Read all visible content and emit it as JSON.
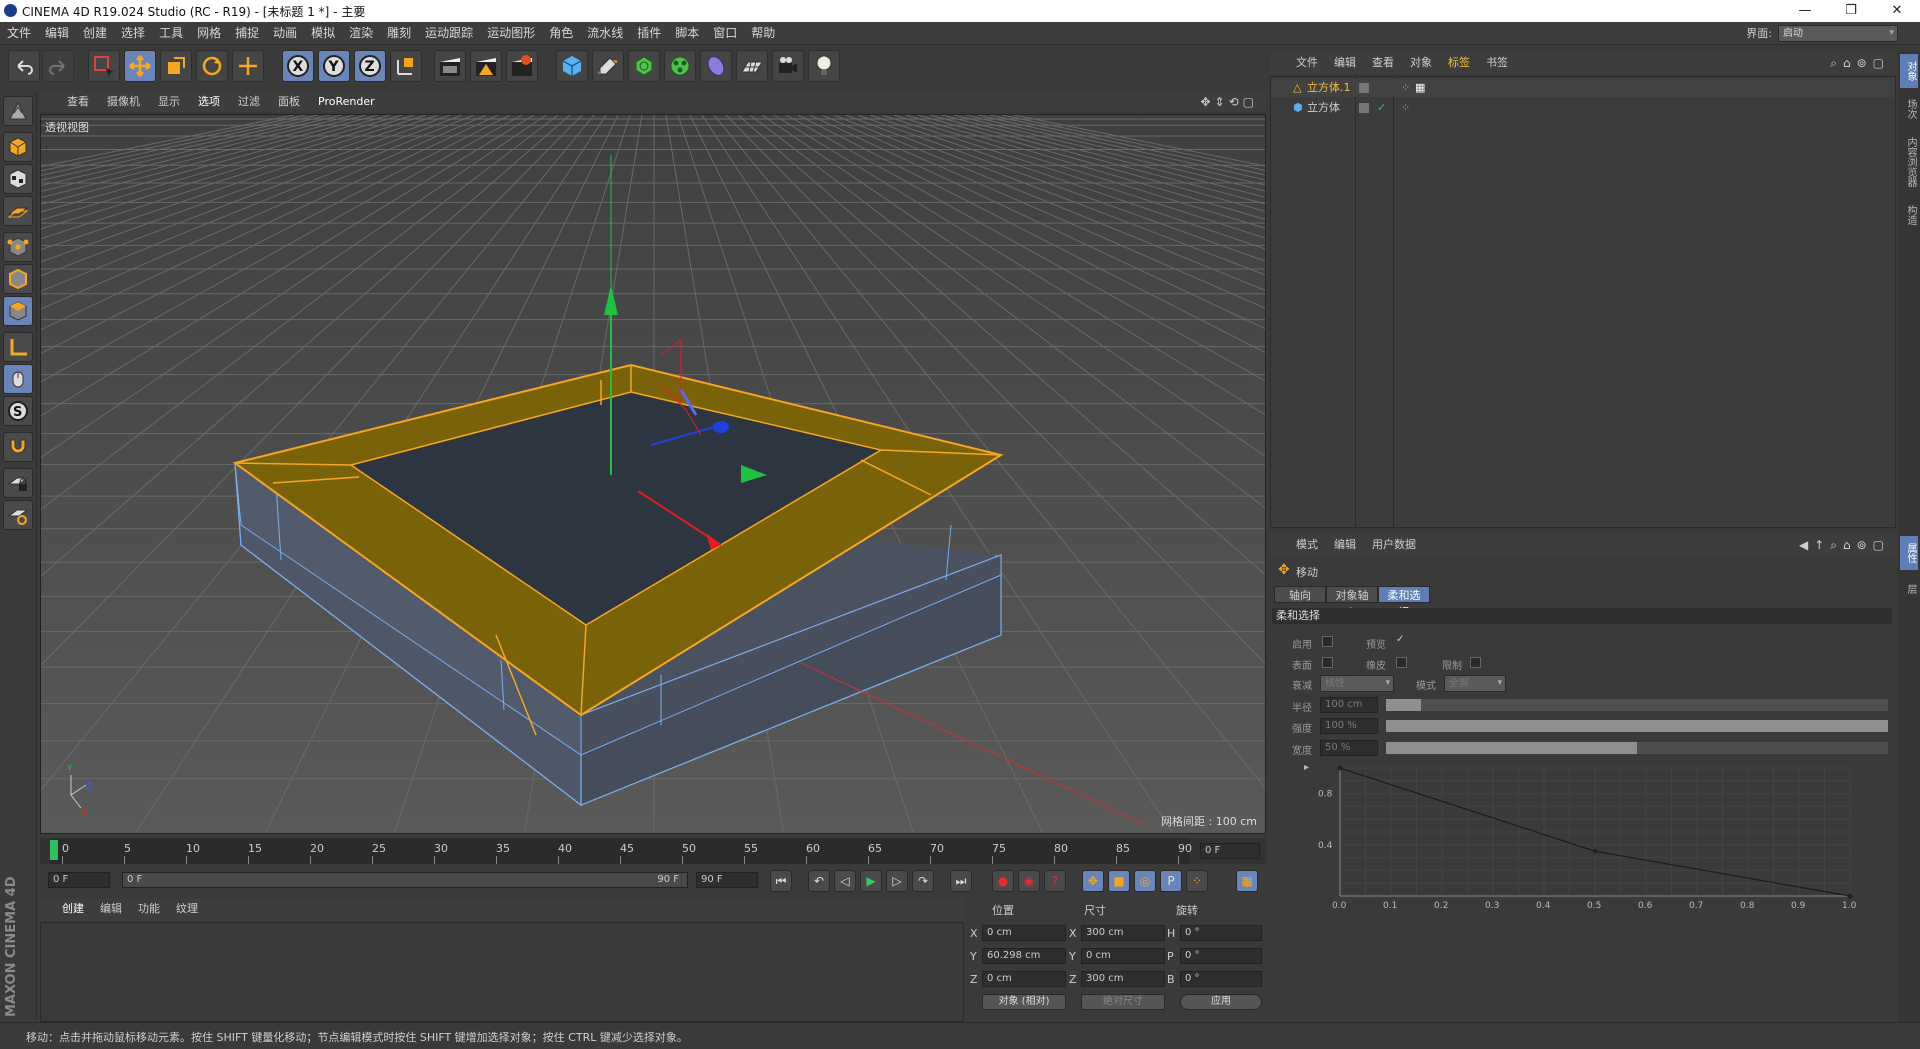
{
  "title": "CINEMA 4D R19.024 Studio (RC - R19) - [未标题 1 *] - 主要",
  "window_buttons": [
    "—",
    "❐",
    "✕"
  ],
  "menu": [
    "文件",
    "编辑",
    "创建",
    "选择",
    "工具",
    "网格",
    "捕捉",
    "动画",
    "模拟",
    "渲染",
    "雕刻",
    "运动跟踪",
    "运动图形",
    "角色",
    "流水线",
    "插件",
    "脚本",
    "窗口",
    "帮助"
  ],
  "layout_label": "界面:",
  "layout_value": "启动",
  "viewport_menu": [
    "查看",
    "摄像机",
    "显示",
    "选项",
    "过滤",
    "面板",
    "ProRender"
  ],
  "viewport_label": "透视视图",
  "grid_label": "网格间距 : 100 cm",
  "timeline": {
    "ticks": [
      "0",
      "5",
      "10",
      "15",
      "20",
      "25",
      "30",
      "35",
      "40",
      "45",
      "50",
      "55",
      "60",
      "65",
      "70",
      "75",
      "80",
      "85",
      "90"
    ],
    "current_frame": "0 F",
    "start": "0 F",
    "range_start": "0 F",
    "range_end": "90 F",
    "end": "90 F"
  },
  "material_menu": [
    "创建",
    "编辑",
    "功能",
    "纹理"
  ],
  "coords": {
    "headers": [
      "位置",
      "尺寸",
      "旋转"
    ],
    "rows": [
      {
        "ax1": "X",
        "pos": "0 cm",
        "ax2": "X",
        "size": "300 cm",
        "ax3": "H",
        "rot": "0 °"
      },
      {
        "ax1": "Y",
        "pos": "60.298 cm",
        "ax2": "Y",
        "size": "0 cm",
        "ax3": "P",
        "rot": "0 °"
      },
      {
        "ax1": "Z",
        "pos": "0 cm",
        "ax2": "Z",
        "size": "300 cm",
        "ax3": "B",
        "rot": "0 °"
      }
    ],
    "mode_btn": "对象 (相对)",
    "size_btn": "绝对尺寸",
    "apply_btn": "应用"
  },
  "status": "移动：点击并拖动鼠标移动元素。按住 SHIFT 键量化移动；节点编辑模式时按住 SHIFT 键增加选择对象；按住 CTRL 键减少选择对象。",
  "object_menu": [
    "文件",
    "编辑",
    "查看",
    "对象",
    "标签",
    "书签"
  ],
  "objects": [
    {
      "name": "立方体.1",
      "selected": true
    },
    {
      "name": "立方体",
      "selected": false
    }
  ],
  "attr_menu": [
    "模式",
    "编辑",
    "用户数据"
  ],
  "attr": {
    "tool_name": "移动",
    "tabs": [
      "轴向",
      "对象轴心",
      "柔和选择"
    ],
    "active_tab": 2,
    "section": "柔和选择",
    "enable": "启用",
    "preview": "预览",
    "surface": "表面",
    "rubber": "橡皮",
    "limit": "限制",
    "falloff_label": "衰减",
    "falloff_value": "线性",
    "mode_label": "模式",
    "mode_value": "全部",
    "radius_label": "半径",
    "radius_value": "100 cm",
    "radius_fill": 0.07,
    "strength_label": "强度",
    "strength_value": "100 %",
    "strength_fill": 1.0,
    "width_label": "宽度",
    "width_value": "50 %",
    "width_fill": 0.5,
    "graph_y": [
      "0.8",
      "0.4"
    ],
    "graph_x": [
      "0.0",
      "0.1",
      "0.2",
      "0.3",
      "0.4",
      "0.5",
      "0.6",
      "0.7",
      "0.8",
      "0.9",
      "1.0"
    ]
  },
  "right_tabs": [
    "对象",
    "场次",
    "内容浏览器",
    "构造"
  ],
  "right_tabs_lower": [
    "属性",
    "层"
  ],
  "maxon": "MAXON CINEMA 4D",
  "colors": {
    "accent": "#5d7fb6",
    "selection": "#f5a623",
    "axis_x": "#e02020",
    "axis_y": "#20c040",
    "axis_z": "#2040e0"
  }
}
